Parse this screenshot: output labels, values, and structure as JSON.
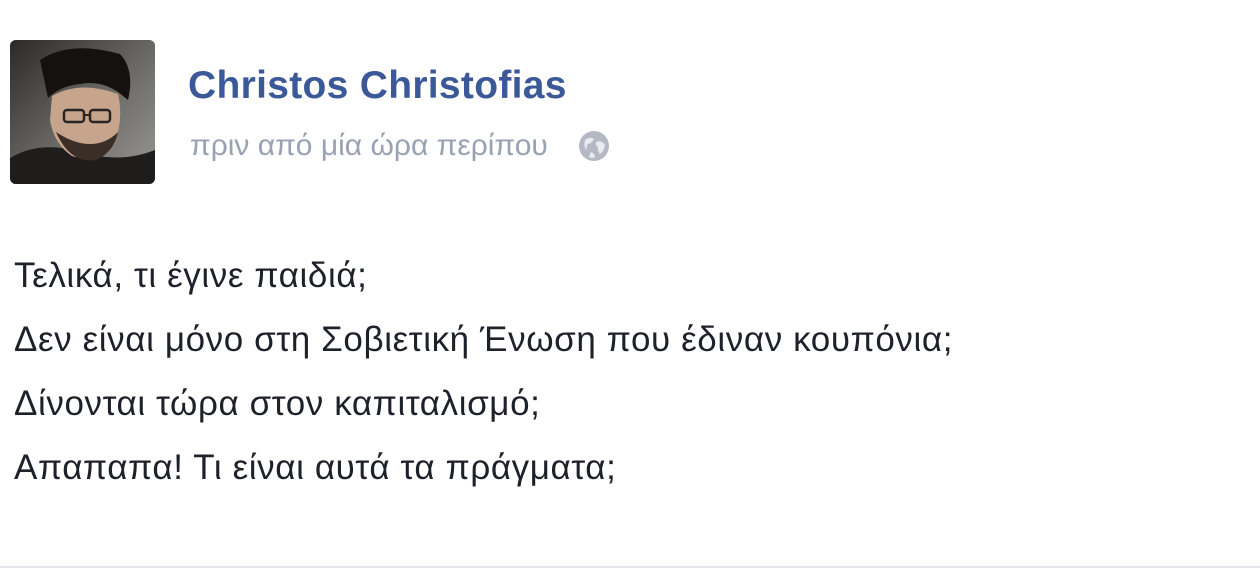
{
  "post": {
    "author": "Christos Christofias",
    "timestamp": "πριν από μία ώρα περίπου",
    "privacy_icon": "globe-icon",
    "lines": [
      "Τελικά, τι έγινε παιδιά;",
      "Δεν είναι μόνο στη Σοβιετική Ένωση που έδιναν κουπόνια;",
      "Δίνονται τώρα στον καπιταλισμό;",
      "Απαπαπα! Τι είναι αυτά τα πράγματα;"
    ]
  },
  "colors": {
    "author_link": "#3b5998",
    "timestamp": "#98a2b3",
    "body_text": "#1d2129"
  }
}
